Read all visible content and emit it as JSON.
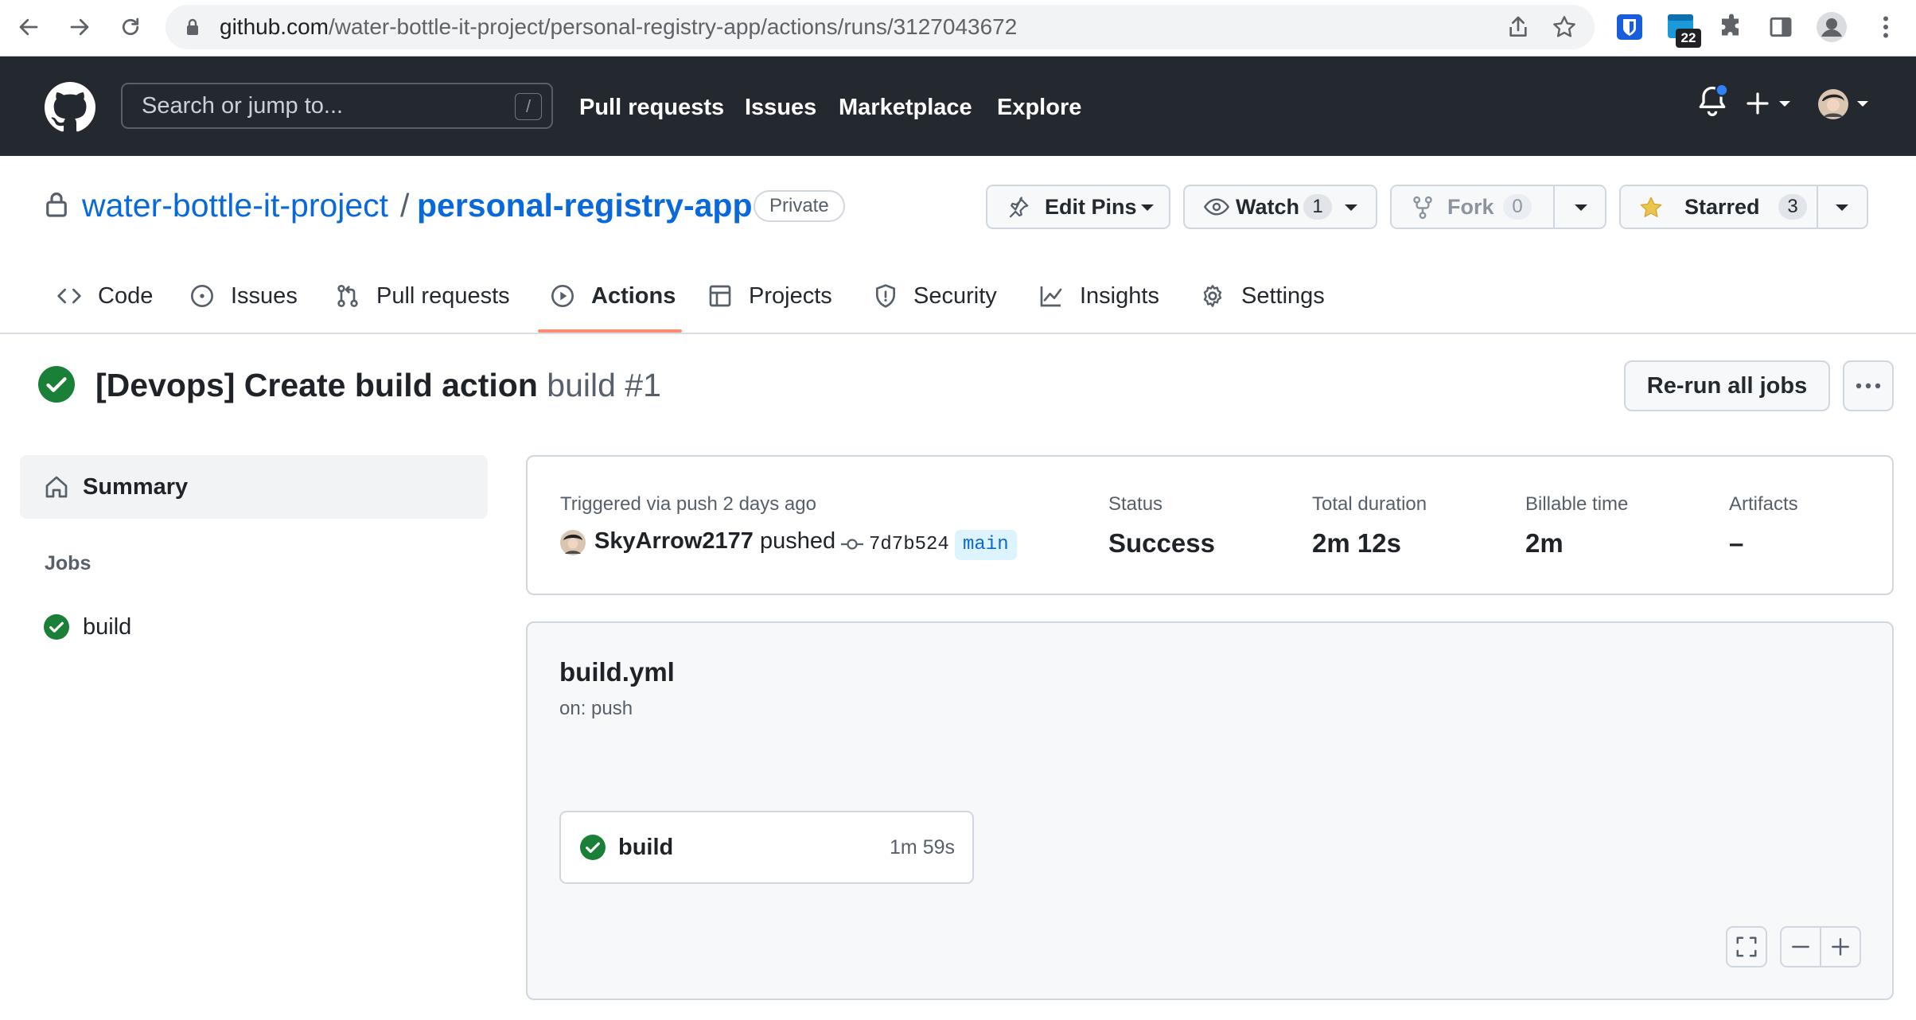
{
  "browser": {
    "url_domain": "github.com",
    "url_path": "/water-bottle-it-project/personal-registry-app/actions/runs/3127043672",
    "extension_badge": "22"
  },
  "header": {
    "search_placeholder": "Search or jump to...",
    "search_shortcut": "/",
    "nav": [
      "Pull requests",
      "Issues",
      "Marketplace",
      "Explore"
    ]
  },
  "repo": {
    "owner": "water-bottle-it-project",
    "separator": "/",
    "name": "personal-registry-app",
    "visibility": "Private",
    "edit_pins_label": "Edit Pins",
    "watch_label": "Watch",
    "watch_count": "1",
    "fork_label": "Fork",
    "fork_count": "0",
    "star_label": "Starred",
    "star_count": "3"
  },
  "tabs": [
    "Code",
    "Issues",
    "Pull requests",
    "Actions",
    "Projects",
    "Security",
    "Insights",
    "Settings"
  ],
  "active_tab": "Actions",
  "run": {
    "title": "[Devops] Create build action",
    "subtitle": "build #1",
    "rerun_label": "Re-run all jobs"
  },
  "sidebar": {
    "summary_label": "Summary",
    "jobs_heading": "Jobs",
    "jobs": [
      {
        "name": "build",
        "status": "success"
      }
    ]
  },
  "summary": {
    "trigger": "Triggered via push 2 days ago",
    "actor": "SkyArrow2177",
    "action": "pushed",
    "commit": "7d7b524",
    "branch": "main",
    "status_label": "Status",
    "status_value": "Success",
    "duration_label": "Total duration",
    "duration_value": "2m 12s",
    "billable_label": "Billable time",
    "billable_value": "2m",
    "artifacts_label": "Artifacts",
    "artifacts_value": "–"
  },
  "workflow": {
    "file": "build.yml",
    "trigger": "on: push",
    "job": {
      "name": "build",
      "duration": "1m 59s",
      "status": "success"
    }
  },
  "colors": {
    "header_bg": "#24292f",
    "link": "#0969da",
    "success": "#1a7f37",
    "active_tab_underline": "#fd8c73",
    "notification_dot": "#2f81f7"
  }
}
